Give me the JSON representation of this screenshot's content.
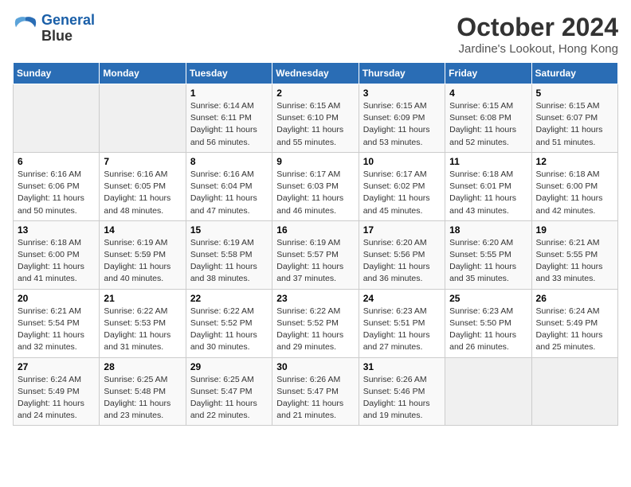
{
  "logo": {
    "line1": "General",
    "line2": "Blue"
  },
  "title": "October 2024",
  "location": "Jardine's Lookout, Hong Kong",
  "days_header": [
    "Sunday",
    "Monday",
    "Tuesday",
    "Wednesday",
    "Thursday",
    "Friday",
    "Saturday"
  ],
  "weeks": [
    [
      {
        "day": "",
        "info": ""
      },
      {
        "day": "",
        "info": ""
      },
      {
        "day": "1",
        "info": "Sunrise: 6:14 AM\nSunset: 6:11 PM\nDaylight: 11 hours and 56 minutes."
      },
      {
        "day": "2",
        "info": "Sunrise: 6:15 AM\nSunset: 6:10 PM\nDaylight: 11 hours and 55 minutes."
      },
      {
        "day": "3",
        "info": "Sunrise: 6:15 AM\nSunset: 6:09 PM\nDaylight: 11 hours and 53 minutes."
      },
      {
        "day": "4",
        "info": "Sunrise: 6:15 AM\nSunset: 6:08 PM\nDaylight: 11 hours and 52 minutes."
      },
      {
        "day": "5",
        "info": "Sunrise: 6:15 AM\nSunset: 6:07 PM\nDaylight: 11 hours and 51 minutes."
      }
    ],
    [
      {
        "day": "6",
        "info": "Sunrise: 6:16 AM\nSunset: 6:06 PM\nDaylight: 11 hours and 50 minutes."
      },
      {
        "day": "7",
        "info": "Sunrise: 6:16 AM\nSunset: 6:05 PM\nDaylight: 11 hours and 48 minutes."
      },
      {
        "day": "8",
        "info": "Sunrise: 6:16 AM\nSunset: 6:04 PM\nDaylight: 11 hours and 47 minutes."
      },
      {
        "day": "9",
        "info": "Sunrise: 6:17 AM\nSunset: 6:03 PM\nDaylight: 11 hours and 46 minutes."
      },
      {
        "day": "10",
        "info": "Sunrise: 6:17 AM\nSunset: 6:02 PM\nDaylight: 11 hours and 45 minutes."
      },
      {
        "day": "11",
        "info": "Sunrise: 6:18 AM\nSunset: 6:01 PM\nDaylight: 11 hours and 43 minutes."
      },
      {
        "day": "12",
        "info": "Sunrise: 6:18 AM\nSunset: 6:00 PM\nDaylight: 11 hours and 42 minutes."
      }
    ],
    [
      {
        "day": "13",
        "info": "Sunrise: 6:18 AM\nSunset: 6:00 PM\nDaylight: 11 hours and 41 minutes."
      },
      {
        "day": "14",
        "info": "Sunrise: 6:19 AM\nSunset: 5:59 PM\nDaylight: 11 hours and 40 minutes."
      },
      {
        "day": "15",
        "info": "Sunrise: 6:19 AM\nSunset: 5:58 PM\nDaylight: 11 hours and 38 minutes."
      },
      {
        "day": "16",
        "info": "Sunrise: 6:19 AM\nSunset: 5:57 PM\nDaylight: 11 hours and 37 minutes."
      },
      {
        "day": "17",
        "info": "Sunrise: 6:20 AM\nSunset: 5:56 PM\nDaylight: 11 hours and 36 minutes."
      },
      {
        "day": "18",
        "info": "Sunrise: 6:20 AM\nSunset: 5:55 PM\nDaylight: 11 hours and 35 minutes."
      },
      {
        "day": "19",
        "info": "Sunrise: 6:21 AM\nSunset: 5:55 PM\nDaylight: 11 hours and 33 minutes."
      }
    ],
    [
      {
        "day": "20",
        "info": "Sunrise: 6:21 AM\nSunset: 5:54 PM\nDaylight: 11 hours and 32 minutes."
      },
      {
        "day": "21",
        "info": "Sunrise: 6:22 AM\nSunset: 5:53 PM\nDaylight: 11 hours and 31 minutes."
      },
      {
        "day": "22",
        "info": "Sunrise: 6:22 AM\nSunset: 5:52 PM\nDaylight: 11 hours and 30 minutes."
      },
      {
        "day": "23",
        "info": "Sunrise: 6:22 AM\nSunset: 5:52 PM\nDaylight: 11 hours and 29 minutes."
      },
      {
        "day": "24",
        "info": "Sunrise: 6:23 AM\nSunset: 5:51 PM\nDaylight: 11 hours and 27 minutes."
      },
      {
        "day": "25",
        "info": "Sunrise: 6:23 AM\nSunset: 5:50 PM\nDaylight: 11 hours and 26 minutes."
      },
      {
        "day": "26",
        "info": "Sunrise: 6:24 AM\nSunset: 5:49 PM\nDaylight: 11 hours and 25 minutes."
      }
    ],
    [
      {
        "day": "27",
        "info": "Sunrise: 6:24 AM\nSunset: 5:49 PM\nDaylight: 11 hours and 24 minutes."
      },
      {
        "day": "28",
        "info": "Sunrise: 6:25 AM\nSunset: 5:48 PM\nDaylight: 11 hours and 23 minutes."
      },
      {
        "day": "29",
        "info": "Sunrise: 6:25 AM\nSunset: 5:47 PM\nDaylight: 11 hours and 22 minutes."
      },
      {
        "day": "30",
        "info": "Sunrise: 6:26 AM\nSunset: 5:47 PM\nDaylight: 11 hours and 21 minutes."
      },
      {
        "day": "31",
        "info": "Sunrise: 6:26 AM\nSunset: 5:46 PM\nDaylight: 11 hours and 19 minutes."
      },
      {
        "day": "",
        "info": ""
      },
      {
        "day": "",
        "info": ""
      }
    ]
  ]
}
